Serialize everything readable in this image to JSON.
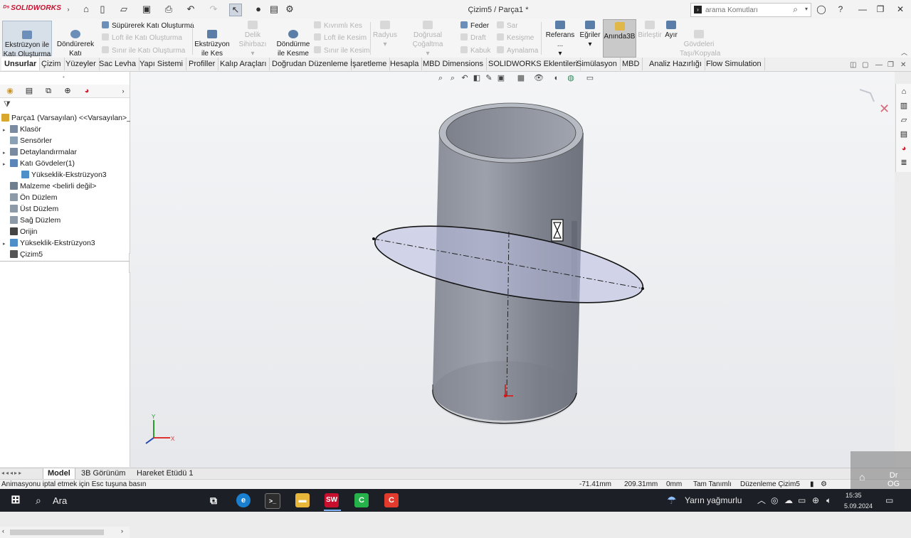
{
  "app": {
    "name": "SOLIDWORKS",
    "doc_title": "Çizim5 / Parça1 *",
    "search_placeholder": "arama Komutları"
  },
  "titlebar_icons": [
    "home-icon",
    "new-file-icon",
    "open-folder-icon",
    "save-icon",
    "print-icon",
    "undo-icon",
    "redo-icon",
    "select-arrow-icon",
    "rebuild-icon",
    "file-properties-icon",
    "options-gear-icon"
  ],
  "ribbon": {
    "extrude_boss": "Ekstrüzyon ile\nKatı Oluşturma",
    "revolve_boss": "Döndürerek\nKatı Oluşturma",
    "sweep_boss": "Süpürerek Katı Oluşturma",
    "loft_boss": "Loft ile Katı Oluşturma",
    "boundary_boss": "Sınır ile Katı Oluşturma",
    "extrude_cut": "Ekstrüzyon\nile Kes",
    "hole_wizard": "Delik Sihirbazı",
    "revolve_cut": "Döndürme\nile Kesme",
    "swept_cut": "Kıvrımlı Kes",
    "loft_cut": "Loft ile Kesim",
    "boundary_cut": "Sınır ile Kesim",
    "fillet": "Radyus",
    "linear_pattern": "Doğrusal Çoğaltma",
    "rib": "Feder",
    "draft": "Draft",
    "shell": "Kabuk",
    "wrap": "Sar",
    "intersect": "Kesişme",
    "mirror": "Aynalama",
    "reference": "Referans ...",
    "curves": "Eğriler",
    "instant3d": "Anında3B",
    "combine": "Birleştir",
    "split": "Ayır",
    "move_copy": "Gövdeleri\nTaşı/Kopyala"
  },
  "command_tabs": [
    "Unsurlar",
    "Çizim",
    "Yüzeyler",
    "Sac Levha",
    "Yapı Sistemi",
    "Profiller",
    "Kalıp Araçları",
    "Doğrudan Düzenleme",
    "İşaretleme",
    "Hesapla",
    "MBD Dimensions",
    "SOLIDWORKS Eklentileri",
    "Simülasyon",
    "MBD",
    "Analiz Hazırlığı",
    "Flow Simulation"
  ],
  "active_tab": "Unsurlar",
  "feature_tree": [
    {
      "label": "Parça1 (Varsayılan) <<Varsayılan>_G",
      "icon": "part-icon",
      "expand": false,
      "indent": 0,
      "color": "#d9a62e"
    },
    {
      "label": "Klasör",
      "icon": "folder-icon",
      "expand": true,
      "indent": 1,
      "color": "#7a8aa0"
    },
    {
      "label": "Sensörler",
      "icon": "sensor-icon",
      "expand": false,
      "indent": 1,
      "color": "#8aa0b4"
    },
    {
      "label": "Detaylandırmalar",
      "icon": "annotations-icon",
      "expand": true,
      "indent": 1,
      "color": "#7a8aa0"
    },
    {
      "label": "Katı Gövdeler(1)",
      "icon": "solid-bodies-icon",
      "expand": true,
      "indent": 1,
      "color": "#5b84b8"
    },
    {
      "label": "Yükseklik-Ekstrüzyon3",
      "icon": "body-icon",
      "expand": false,
      "indent": 2,
      "color": "#4f8fc9"
    },
    {
      "label": "Malzeme <belirli değil>",
      "icon": "material-icon",
      "expand": false,
      "indent": 1,
      "color": "#6f7f8f"
    },
    {
      "label": "Ön Düzlem",
      "icon": "plane-icon",
      "expand": false,
      "indent": 1,
      "color": "#8d9aa8"
    },
    {
      "label": "Üst Düzlem",
      "icon": "plane-icon",
      "expand": false,
      "indent": 1,
      "color": "#8d9aa8"
    },
    {
      "label": "Sağ Düzlem",
      "icon": "plane-icon",
      "expand": false,
      "indent": 1,
      "color": "#8d9aa8"
    },
    {
      "label": "Orijin",
      "icon": "origin-icon",
      "expand": false,
      "indent": 1,
      "color": "#444444"
    },
    {
      "label": "Yükseklik-Ekstrüzyon3",
      "icon": "extrude-feature-icon",
      "expand": true,
      "indent": 1,
      "color": "#4f8fc9"
    },
    {
      "label": "Çizim5",
      "icon": "sketch-icon",
      "expand": false,
      "indent": 1,
      "color": "#555555"
    }
  ],
  "bottom_tabs": [
    "Model",
    "3B Görünüm",
    "Hareket Etüdü 1"
  ],
  "active_bottom_tab": "Model",
  "status": {
    "message": "Animasyonu iptal etmek için Esc tuşuna basın",
    "x": "-71.41mm",
    "y": "209.31mm",
    "z": "0mm",
    "state": "Tam Tanımlı",
    "mode": "Düzenleme Çizim5"
  },
  "taskbar": {
    "search_label": "Ara",
    "weather": "Yarın yağmurlu",
    "time": "15:35",
    "date": "5.09.2024"
  },
  "watermark": "Dr\nOG"
}
